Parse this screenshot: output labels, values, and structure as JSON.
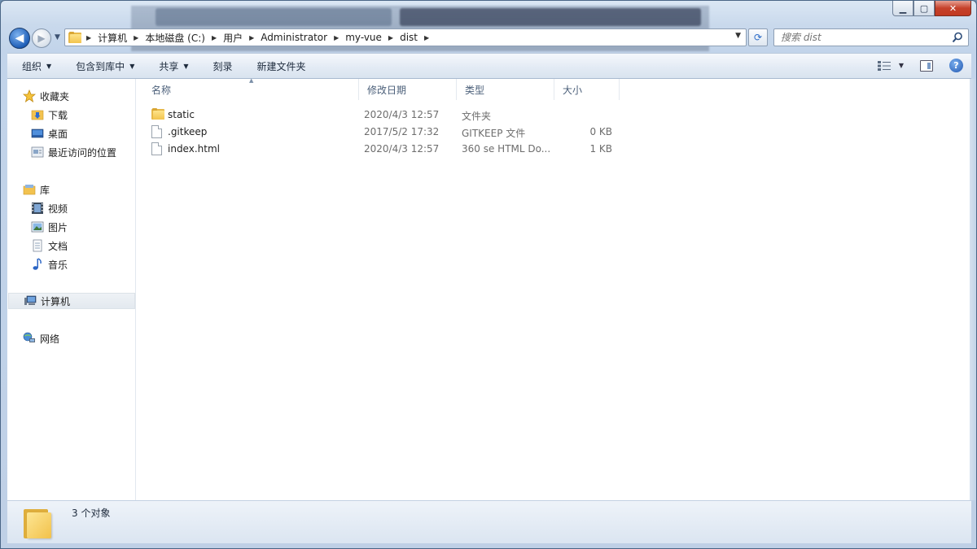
{
  "window": {
    "controls": {
      "minimize": "▁",
      "maximize": "▢",
      "close": "✕"
    }
  },
  "nav": {
    "back_label": "◀",
    "forward_label": "▶",
    "recent_label": "▼",
    "breadcrumbs": [
      "计算机",
      "本地磁盘 (C:)",
      "用户",
      "Administrator",
      "my-vue",
      "dist"
    ],
    "refresh_label": "⟳",
    "search_placeholder": "搜索 dist"
  },
  "toolbar": {
    "organize": "组织",
    "include_library": "包含到库中",
    "share": "共享",
    "burn": "刻录",
    "new_folder": "新建文件夹"
  },
  "sidebar": {
    "favorites": {
      "label": "收藏夹",
      "items": [
        "下载",
        "桌面",
        "最近访问的位置"
      ]
    },
    "libraries": {
      "label": "库",
      "items": [
        "视频",
        "图片",
        "文档",
        "音乐"
      ]
    },
    "computer": "计算机",
    "network": "网络"
  },
  "columns": {
    "name": "名称",
    "date": "修改日期",
    "type": "类型",
    "size": "大小"
  },
  "files": [
    {
      "name": "static",
      "date": "2020/4/3 12:57",
      "type": "文件夹",
      "size": "",
      "icon": "folder-icon"
    },
    {
      "name": ".gitkeep",
      "date": "2017/5/2 17:32",
      "type": "GITKEEP 文件",
      "size": "0 KB",
      "icon": "file-icon"
    },
    {
      "name": "index.html",
      "date": "2020/4/3 12:57",
      "type": "360 se HTML Do...",
      "size": "1 KB",
      "icon": "file-icon"
    }
  ],
  "status": {
    "count": "3 个对象"
  },
  "colors": {
    "accent": "#1f5fb8",
    "folder": "#f3c44e",
    "chrome": "#c9d9ec"
  }
}
